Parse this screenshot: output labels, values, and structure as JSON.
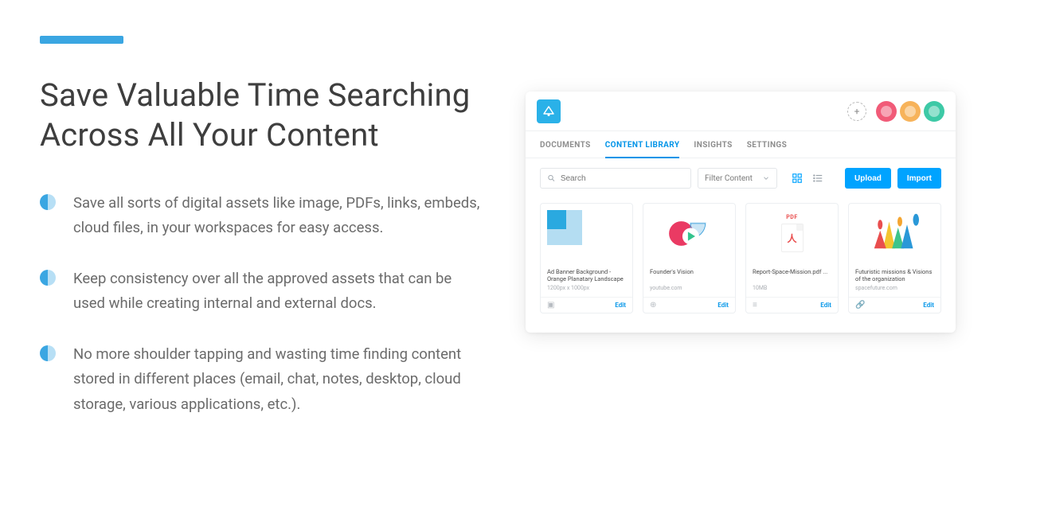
{
  "left": {
    "headline": "Save Valuable Time Searching Across All Your Content",
    "bullets": [
      "Save all sorts of digital assets like image, PDFs, links, embeds, cloud files, in your workspaces for easy access.",
      "Keep consistency over all the approved assets that can be used while creating internal and external docs.",
      "No more shoulder tapping and wasting time finding content stored in different places (email, chat, notes, desktop, cloud storage, various applications, etc.)."
    ]
  },
  "app": {
    "tabs": [
      "DOCUMENTS",
      "CONTENT LIBRARY",
      "INSIGHTS",
      "SETTINGS"
    ],
    "activeTabIndex": 1,
    "search": {
      "placeholder": "Search"
    },
    "filter": {
      "label": "Filter Content"
    },
    "buttons": {
      "upload": "Upload",
      "import": "Import"
    },
    "editLabel": "Edit",
    "addLabel": "+",
    "cards": [
      {
        "title": "Ad Banner Background - Orange Planatary Landscape",
        "sub": "1200px x 1000px",
        "footIcon": "image-icon"
      },
      {
        "title": "Founder's Vision",
        "sub": "youtube.com",
        "footIcon": "globe-icon"
      },
      {
        "title": "Report-Space-Mission.pdf ...",
        "sub": "10MB",
        "footIcon": "file-icon",
        "pdfBadge": "PDF"
      },
      {
        "title": "Futuristic missions & Visions of the organization",
        "sub": "spacefuture.com",
        "footIcon": "link-icon"
      }
    ]
  }
}
